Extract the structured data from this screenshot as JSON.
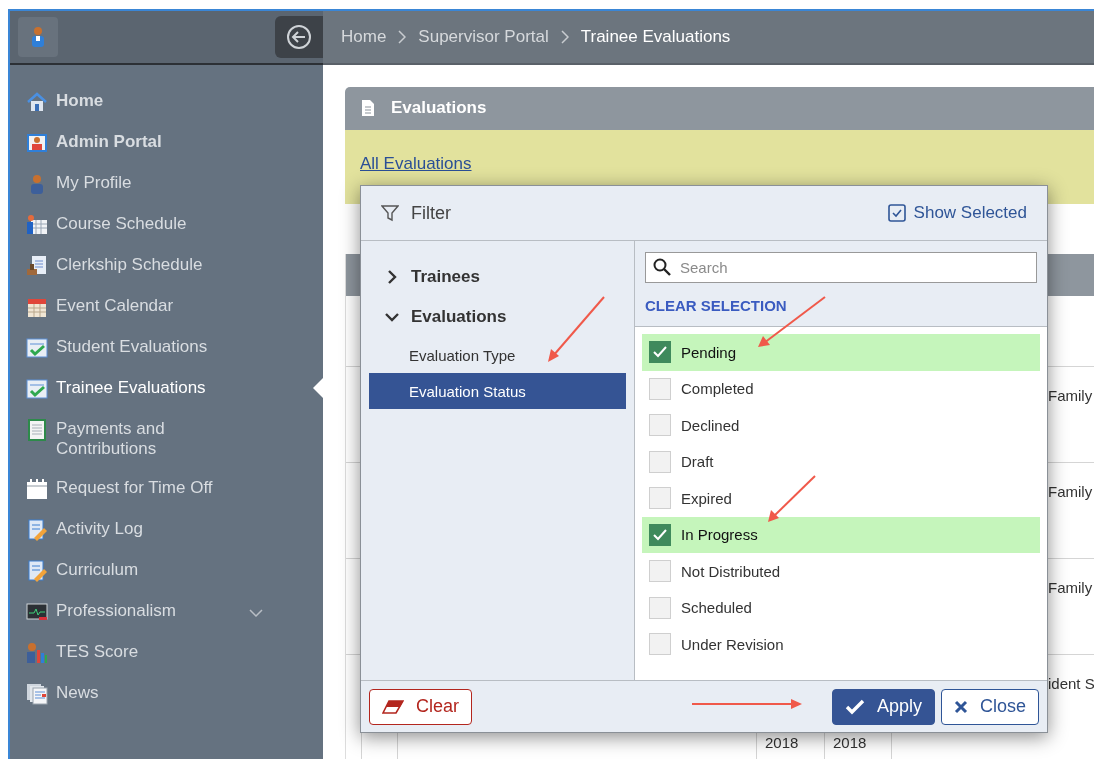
{
  "breadcrumb": [
    {
      "label": "Home",
      "current": false
    },
    {
      "label": "Supervisor Portal",
      "current": false
    },
    {
      "label": "Trainee Evaluations",
      "current": true
    }
  ],
  "sidebar": {
    "items": [
      {
        "label": "Home",
        "selected": false,
        "bold": true,
        "kind": "link"
      },
      {
        "label": "Admin Portal",
        "selected": false,
        "bold": true,
        "kind": "link"
      },
      {
        "label": "My Profile",
        "selected": false,
        "bold": false,
        "kind": "link"
      },
      {
        "label": "Course Schedule",
        "selected": false,
        "bold": false,
        "kind": "link"
      },
      {
        "label": "Clerkship Schedule",
        "selected": false,
        "bold": false,
        "kind": "link"
      },
      {
        "label": "Event Calendar",
        "selected": false,
        "bold": false,
        "kind": "link"
      },
      {
        "label": "Student Evaluations",
        "selected": false,
        "bold": false,
        "kind": "link"
      },
      {
        "label": "Trainee Evaluations",
        "selected": true,
        "bold": false,
        "kind": "link"
      },
      {
        "label": "Payments and Contributions",
        "selected": false,
        "bold": false,
        "kind": "link"
      },
      {
        "label": "Request for Time Off",
        "selected": false,
        "bold": false,
        "kind": "link"
      },
      {
        "label": "Activity Log",
        "selected": false,
        "bold": false,
        "kind": "link"
      },
      {
        "label": "Curriculum",
        "selected": false,
        "bold": false,
        "kind": "link"
      },
      {
        "label": "Professionalism",
        "selected": false,
        "bold": false,
        "kind": "group"
      },
      {
        "label": "TES Score",
        "selected": false,
        "bold": false,
        "kind": "link"
      },
      {
        "label": "News",
        "selected": false,
        "bold": false,
        "kind": "link"
      }
    ]
  },
  "panel": {
    "title": "Evaluations",
    "link": "All Evaluations"
  },
  "table": {
    "rows": [
      {
        "column_6": "Family"
      },
      {
        "column_6": "Family"
      },
      {
        "column_6": "Family"
      },
      {
        "column_4": "2018",
        "column_5": "2018",
        "column_6": "ident S"
      }
    ]
  },
  "filter": {
    "title": "Filter",
    "show_selected": {
      "label": "Show Selected",
      "checked": true
    },
    "tree": [
      {
        "label": "Trainees",
        "expanded": false,
        "selected": false
      },
      {
        "label": "Evaluations",
        "expanded": true,
        "selected": false,
        "children": [
          {
            "label": "Evaluation Type",
            "selected": false
          },
          {
            "label": "Evaluation Status",
            "selected": true
          }
        ]
      }
    ],
    "search": {
      "placeholder": "Search"
    },
    "clear_selection": "CLEAR SELECTION",
    "options": [
      {
        "label": "Pending",
        "checked": true
      },
      {
        "label": "Completed",
        "checked": false
      },
      {
        "label": "Declined",
        "checked": false
      },
      {
        "label": "Draft",
        "checked": false
      },
      {
        "label": "Expired",
        "checked": false
      },
      {
        "label": "In Progress",
        "checked": true
      },
      {
        "label": "Not Distributed",
        "checked": false
      },
      {
        "label": "Scheduled",
        "checked": false
      },
      {
        "label": "Under Revision",
        "checked": false
      }
    ],
    "buttons": [
      {
        "label": "Clear",
        "kind": "clear"
      },
      {
        "label": "Apply",
        "kind": "apply"
      },
      {
        "label": "Close",
        "kind": "close"
      }
    ]
  }
}
